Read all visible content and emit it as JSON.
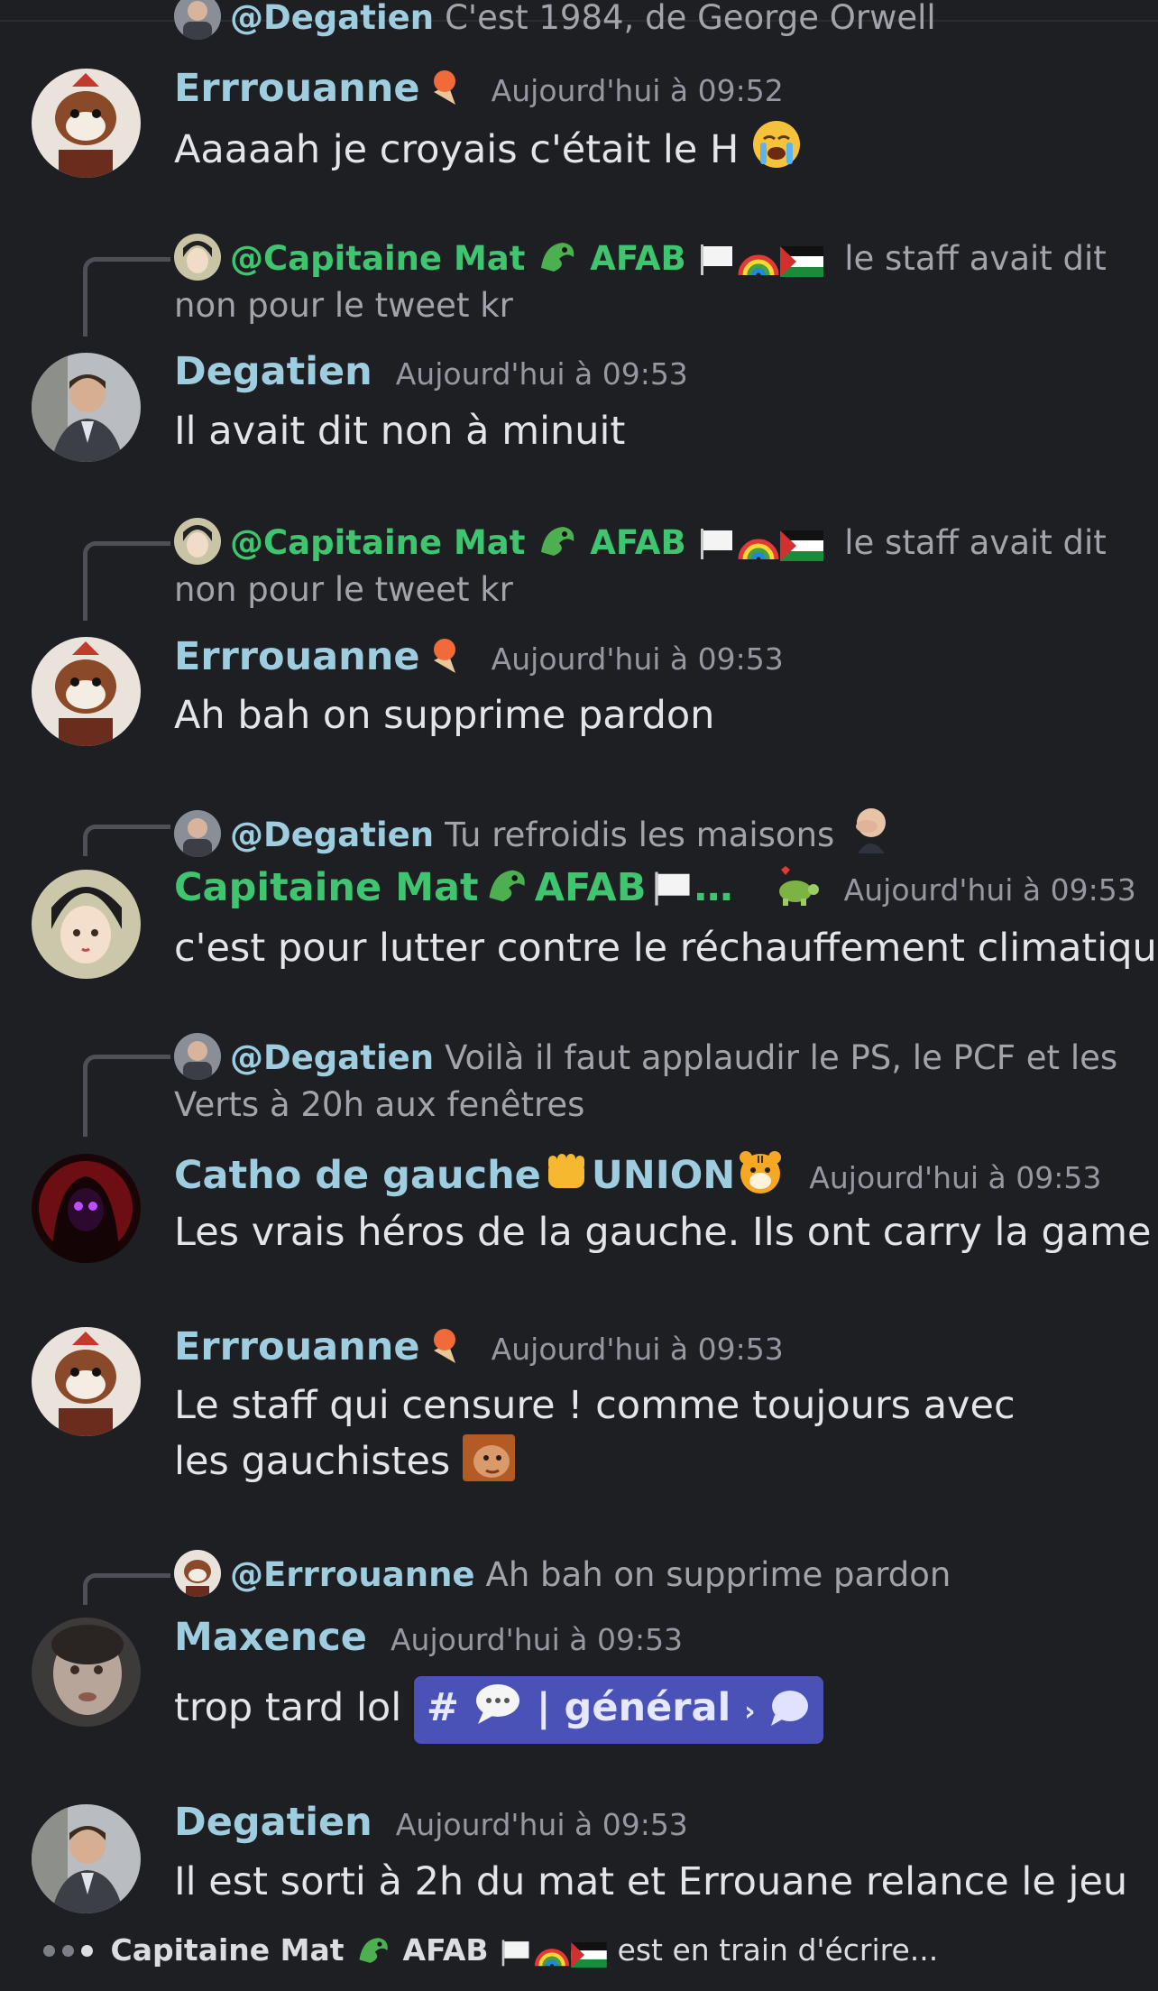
{
  "messages": [
    {
      "reply": {
        "user": "@Degatien",
        "text": "C'est 1984, de George Orwell"
      }
    },
    {
      "user": "Errrouanne",
      "timestamp": "Aujourd'hui à 09:52",
      "text": "Aaaaah je croyais c'était le H"
    },
    {
      "reply": {
        "user": "@Capitaine Mat",
        "tag": "AFAB",
        "text": "le staff avait dit non pour le tweet kr"
      },
      "user": "Degatien",
      "timestamp": "Aujourd'hui à 09:53",
      "text": "Il avait dit non à minuit"
    },
    {
      "reply": {
        "user": "@Capitaine Mat",
        "tag": "AFAB",
        "text": "le staff avait dit non pour le tweet kr"
      },
      "user": "Errrouanne",
      "timestamp": "Aujourd'hui à 09:53",
      "text": "Ah bah on supprime pardon"
    },
    {
      "reply": {
        "user": "@Degatien",
        "text": "Tu refroidis les maisons"
      },
      "user": "Capitaine Mat",
      "user_tag": "AFAB",
      "user_ellipsis": "…",
      "timestamp": "Aujourd'hui à 09:53",
      "text": "c'est pour lutter contre le réchauffement climatique"
    },
    {
      "reply": {
        "user": "@Degatien",
        "text": "Voilà il faut applaudir le PS, le PCF et les Verts à 20h aux fenêtres"
      },
      "user": "Catho de gauche",
      "user_suffix": "UNION",
      "timestamp": "Aujourd'hui à 09:53",
      "text": "Les vrais héros de la gauche. Ils ont carry la game"
    },
    {
      "user": "Errrouanne",
      "timestamp": "Aujourd'hui à 09:53",
      "text": "Le staff qui censure ! comme toujours avec les gauchistes"
    },
    {
      "reply": {
        "user": "@Errrouanne",
        "text": "Ah bah on supprime pardon"
      },
      "user": "Maxence",
      "timestamp": "Aujourd'hui à 09:53",
      "text": "trop tard lol",
      "channel": {
        "hash": "#",
        "name": "général",
        "sep": "|",
        "arrow": "›"
      }
    },
    {
      "user": "Degatien",
      "timestamp": "Aujourd'hui à 09:53",
      "text": "Il est sorti à 2h du mat et Errouane relance le jeu"
    }
  ],
  "typing": {
    "user": "Capitaine Mat",
    "tag": "AFAB",
    "text": "est en train d'écrire..."
  },
  "colors": {
    "background": "#1e1f23",
    "name_default": "#9ecde0",
    "name_green": "#3fc46f",
    "channel_chip": "#4a52b8"
  }
}
